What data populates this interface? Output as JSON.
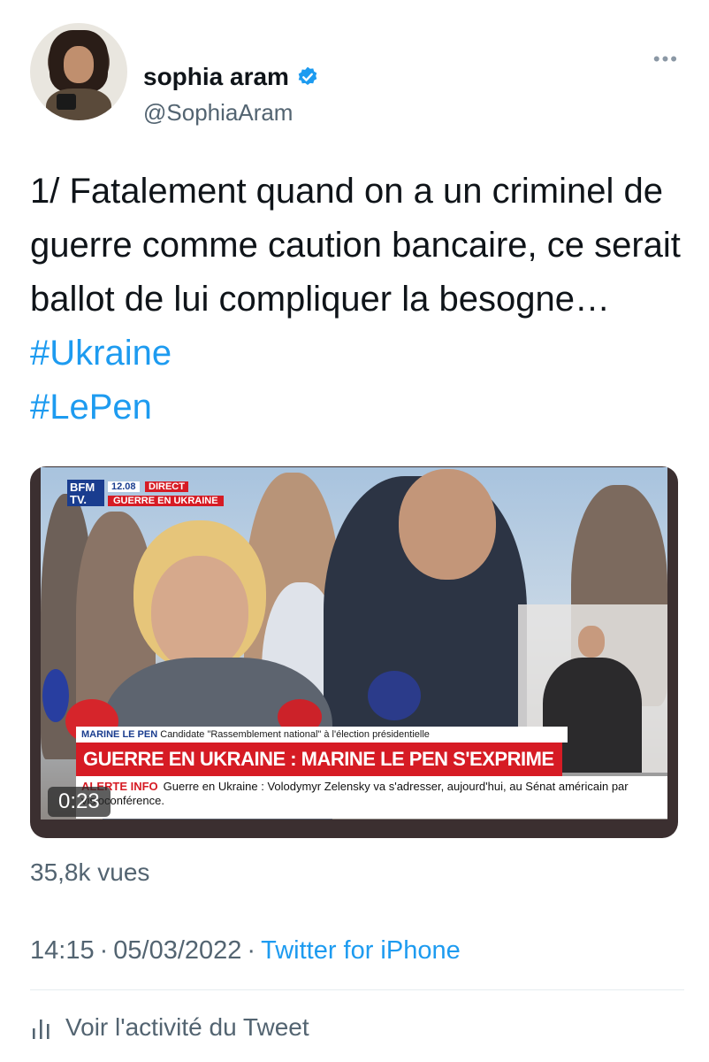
{
  "author": {
    "display_name": "sophia aram",
    "handle": "@SophiaAram",
    "verified": true
  },
  "more_menu": "•••",
  "tweet": {
    "text_plain": "1/ Fatalement quand on a un criminel de guerre comme caution bancaire, ce serait ballot de lui compliquer la besogne… ",
    "hashtag_1": "#Ukraine",
    "hashtag_2": "#LePen"
  },
  "media": {
    "channel_logo": "BFM TV.",
    "time": "12.08",
    "live_label": "DIRECT",
    "topic": "GUERRE EN UKRAINE",
    "speaker_name": "MARINE LE PEN",
    "speaker_role": "Candidate \"Rassemblement national\" à l'élection présidentielle",
    "headline": "GUERRE EN UKRAINE : MARINE LE PEN S'EXPRIME",
    "ticker_alert": "ALERTE INFO",
    "ticker_text": "Guerre en Ukraine : Volodymyr Zelensky va s'adresser, aujourd'hui, au Sénat américain par visioconférence.",
    "duration": "0:23"
  },
  "stats": {
    "views": "35,8k vues"
  },
  "meta": {
    "time": "14:15",
    "separator": "·",
    "date": "05/03/2022",
    "source": "Twitter for iPhone"
  },
  "activity": {
    "label": "Voir l'activité du Tweet"
  },
  "colors": {
    "link": "#1d9bf0",
    "secondary_text": "#536471",
    "bfm_red": "#d61b24",
    "bfm_blue": "#1a3d8f"
  },
  "icons": [
    "verified-badge-icon",
    "more-icon",
    "activity-chart-icon"
  ]
}
